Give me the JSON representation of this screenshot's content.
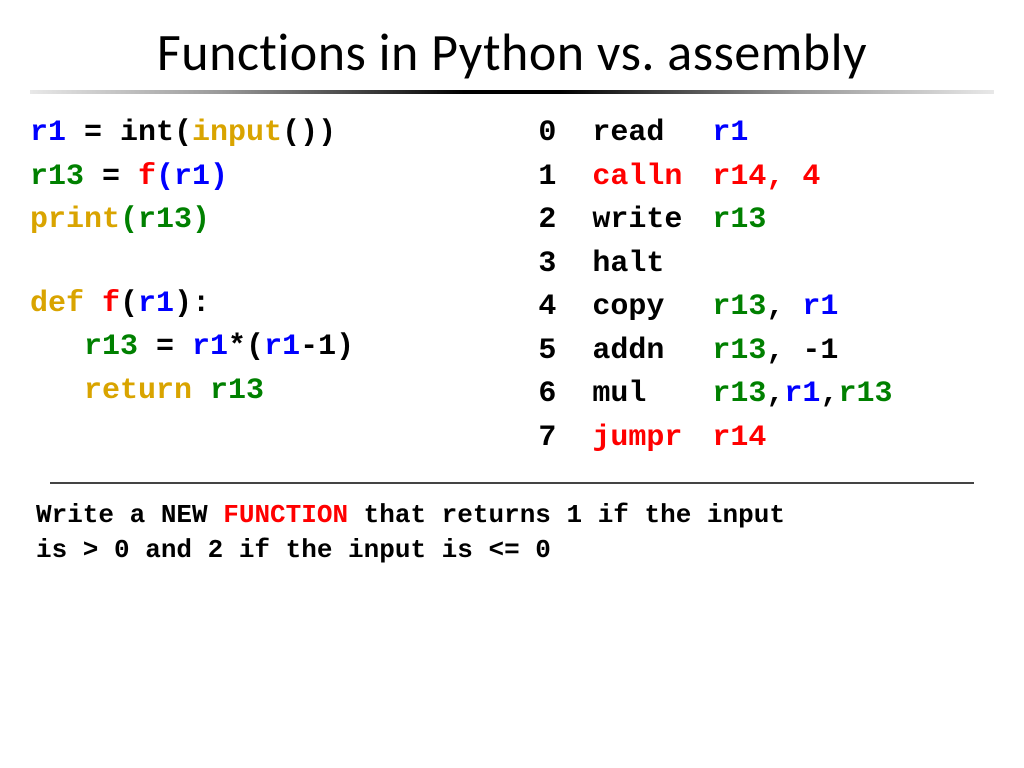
{
  "title": "Functions in Python vs. assembly",
  "python": {
    "l1": {
      "r1": "r1",
      "eq": " = ",
      "int": "int(",
      "input": "input",
      "close": "())"
    },
    "l2": {
      "r13": "r13",
      "eq": " = ",
      "f": "f",
      "args": "(r1)"
    },
    "l3": {
      "print": "print",
      "args": "(r13)"
    },
    "l4": {
      "def": "def ",
      "f": "f",
      "open": "(",
      "r1": "r1",
      "close": "):"
    },
    "l5": {
      "r13": "r13",
      "eq": " = ",
      "r1a": "r1",
      "star": "*(",
      "r1b": "r1",
      "minus": "-1)"
    },
    "l6": {
      "ret": "return ",
      "r13": "r13"
    }
  },
  "asm": [
    {
      "n": "0",
      "op": "read",
      "op_color": "c-black",
      "args": [
        {
          "t": "r1",
          "c": "c-blue"
        }
      ]
    },
    {
      "n": "1",
      "op": "calln",
      "op_color": "c-red",
      "args": [
        {
          "t": "r14, 4",
          "c": "c-red"
        }
      ]
    },
    {
      "n": "2",
      "op": "write",
      "op_color": "c-black",
      "args": [
        {
          "t": "r13",
          "c": "c-green"
        }
      ]
    },
    {
      "n": "3",
      "op": "halt",
      "op_color": "c-black",
      "args": []
    },
    {
      "n": "4",
      "op": "copy",
      "op_color": "c-black",
      "args": [
        {
          "t": "r13",
          "c": "c-green"
        },
        {
          "t": ", ",
          "c": "c-black"
        },
        {
          "t": "r1",
          "c": "c-blue"
        }
      ]
    },
    {
      "n": "5",
      "op": "addn",
      "op_color": "c-black",
      "args": [
        {
          "t": "r13",
          "c": "c-green"
        },
        {
          "t": ", -1",
          "c": "c-black"
        }
      ]
    },
    {
      "n": "6",
      "op": "mul",
      "op_color": "c-black",
      "args": [
        {
          "t": "r13",
          "c": "c-green"
        },
        {
          "t": ",",
          "c": "c-black"
        },
        {
          "t": "r1",
          "c": "c-blue"
        },
        {
          "t": ",",
          "c": "c-black"
        },
        {
          "t": "r13",
          "c": "c-green"
        }
      ]
    },
    {
      "n": "7",
      "op": "jumpr",
      "op_color": "c-red",
      "args": [
        {
          "t": "r14",
          "c": "c-red"
        }
      ]
    }
  ],
  "prompt": {
    "p1a": "Write a NEW ",
    "p1b": "FUNCTION",
    "p1c": " that returns 1 if the input",
    "p2": "is > 0 and 2 if the input is <= 0"
  }
}
